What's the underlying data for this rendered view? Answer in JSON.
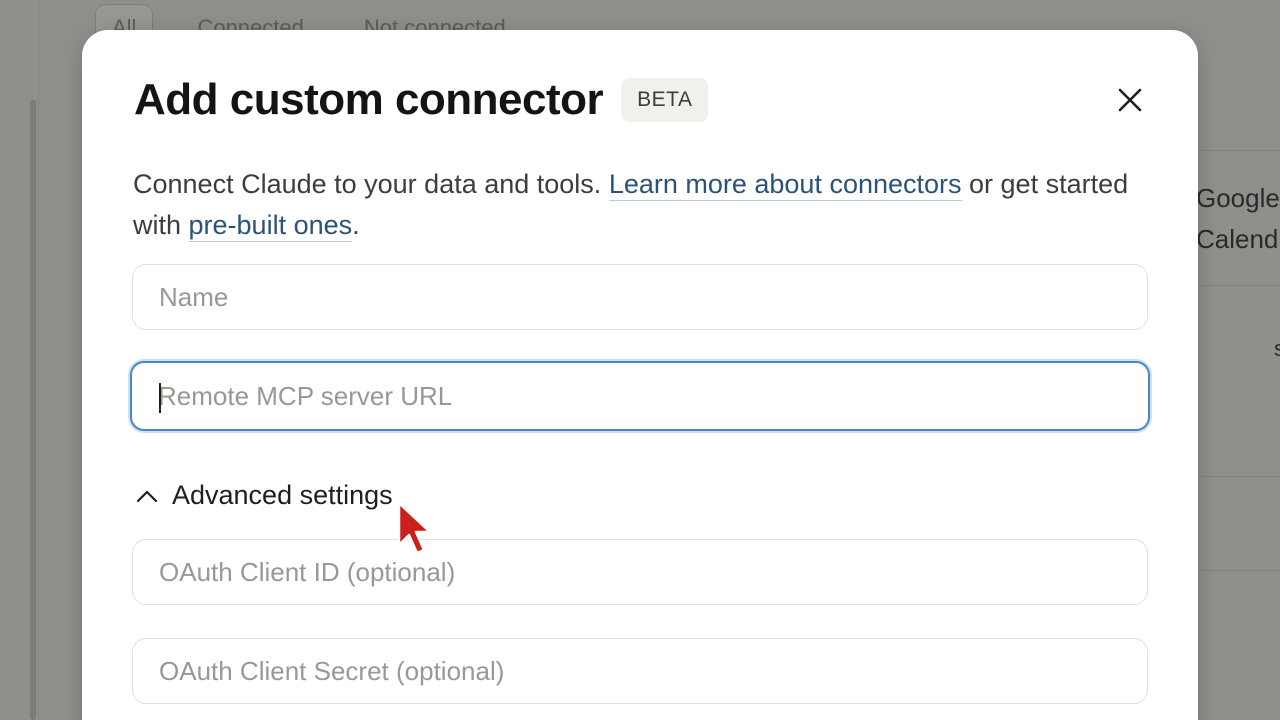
{
  "background": {
    "filters": [
      "All",
      "Connected",
      "Not connected"
    ],
    "card_title_lines": [
      "Google",
      "Calend"
    ],
    "card_fragment": "s"
  },
  "modal": {
    "title": "Add custom connector",
    "badge": "BETA",
    "intro": {
      "text_before": "Connect Claude to your data and tools. ",
      "link_learn": "Learn more about connectors",
      "text_middle": " or get started with ",
      "link_prebuilt": "pre-built ones",
      "text_after": "."
    },
    "fields": {
      "name": {
        "placeholder": "Name",
        "value": ""
      },
      "url": {
        "placeholder": "Remote MCP server URL",
        "value": ""
      },
      "oauth_id": {
        "placeholder": "OAuth Client ID (optional)",
        "value": ""
      },
      "oauth_secret": {
        "placeholder": "OAuth Client Secret (optional)",
        "value": ""
      }
    },
    "advanced_label": "Advanced settings"
  },
  "colors": {
    "link": "#2b5378",
    "focus_ring": "#4a86c4",
    "cursor": "#cc1f1a"
  },
  "icons": {
    "close": "close-icon",
    "advanced_toggle": "chevron-up-icon",
    "pointer": "mouse-pointer-icon"
  }
}
